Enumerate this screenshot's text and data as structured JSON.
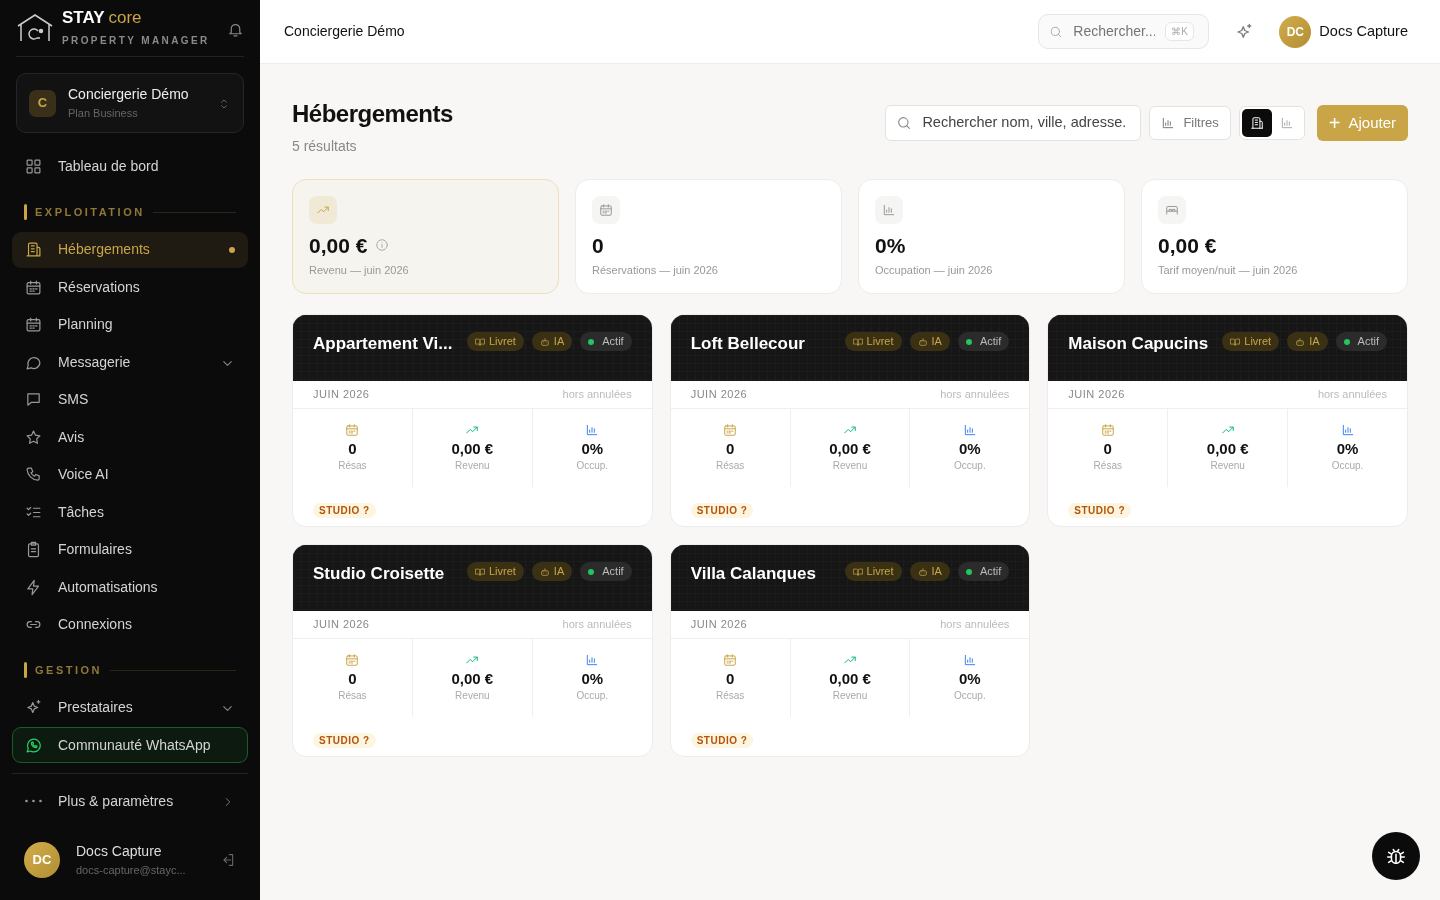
{
  "sidebar": {
    "brand": {
      "name": "STAY",
      "suffix": "core",
      "tagline": "PROPERTY MANAGER"
    },
    "org": {
      "initial": "C",
      "name": "Conciergerie Démo",
      "plan": "Plan Business"
    },
    "items": [
      {
        "kind": "link",
        "label": "Tableau de bord",
        "selected": false
      },
      {
        "kind": "section",
        "label": "EXPLOITATION"
      },
      {
        "kind": "link",
        "label": "Hébergements",
        "selected": true
      },
      {
        "kind": "link",
        "label": "Réservations",
        "selected": false
      },
      {
        "kind": "link",
        "label": "Planning",
        "selected": false
      },
      {
        "kind": "group",
        "label": "Messagerie",
        "expanded": false
      },
      {
        "kind": "link",
        "label": "SMS",
        "selected": false
      },
      {
        "kind": "link",
        "label": "Avis",
        "selected": false
      },
      {
        "kind": "link",
        "label": "Voice AI",
        "selected": false
      },
      {
        "kind": "link",
        "label": "Tâches",
        "selected": false
      },
      {
        "kind": "link",
        "label": "Formulaires",
        "selected": false
      },
      {
        "kind": "link",
        "label": "Automatisations",
        "selected": false
      },
      {
        "kind": "link",
        "label": "Connexions",
        "selected": false
      },
      {
        "kind": "section",
        "label": "GESTION"
      },
      {
        "kind": "group",
        "label": "Prestataires",
        "expanded": false
      },
      {
        "kind": "whatsapp",
        "label": "Communauté WhatsApp"
      },
      {
        "kind": "more",
        "label": "Plus & paramètres"
      }
    ],
    "user": {
      "initials": "DC",
      "name": "Docs Capture",
      "email": "docs-capture@stayc..."
    }
  },
  "topbar": {
    "title": "Conciergerie Démo",
    "search": {
      "placeholder": "Rechercher...",
      "shortcut": "⌘K"
    },
    "user": {
      "initials": "DC",
      "name": "Docs Capture"
    }
  },
  "page": {
    "title": "Hébergements",
    "count": "5 résultats",
    "search": {
      "placeholder": "Rechercher nom, ville, adresse."
    },
    "filters": "Filtres",
    "views": [
      {
        "kind": "grid",
        "selected": true
      },
      {
        "kind": "stats",
        "selected": false
      }
    ],
    "add": {
      "icon": "+",
      "label": "Ajouter"
    }
  },
  "stats": [
    {
      "kind": "revenue",
      "value": "0,00 €",
      "label": "Revenu — juin 2026",
      "highlighted": true,
      "info": true
    },
    {
      "kind": "bookings",
      "value": "0",
      "label": "Réservations — juin 2026",
      "highlighted": false,
      "info": false
    },
    {
      "kind": "occupancy",
      "value": "0%",
      "label": "Occupation — juin 2026",
      "highlighted": false,
      "info": false
    },
    {
      "kind": "rate",
      "value": "0,00 €",
      "label": "Tarif moyen/nuit — juin 2026",
      "highlighted": false,
      "info": false
    }
  ],
  "properties": [
    {
      "name": "Appartement Vi...",
      "badges": [
        {
          "kind": "guide",
          "label": "Livret"
        },
        {
          "kind": "ai",
          "label": "IA"
        },
        {
          "kind": "status",
          "label": "Actif",
          "color": "#22c55e"
        }
      ],
      "month": "JUIN 2026",
      "note": "hors annulées",
      "metrics": [
        {
          "value": "0",
          "label": "Résas"
        },
        {
          "value": "0,00 €",
          "label": "Revenu"
        },
        {
          "value": "0%",
          "label": "Occup."
        }
      ],
      "tag": "STUDIO ?"
    },
    {
      "name": "Loft Bellecour",
      "badges": [
        {
          "kind": "guide",
          "label": "Livret"
        },
        {
          "kind": "ai",
          "label": "IA"
        },
        {
          "kind": "status",
          "label": "Actif",
          "color": "#22c55e"
        }
      ],
      "month": "JUIN 2026",
      "note": "hors annulées",
      "metrics": [
        {
          "value": "0",
          "label": "Résas"
        },
        {
          "value": "0,00 €",
          "label": "Revenu"
        },
        {
          "value": "0%",
          "label": "Occup."
        }
      ],
      "tag": "STUDIO ?"
    },
    {
      "name": "Maison Capucins",
      "badges": [
        {
          "kind": "guide",
          "label": "Livret"
        },
        {
          "kind": "ai",
          "label": "IA"
        },
        {
          "kind": "status",
          "label": "Actif",
          "color": "#22c55e"
        }
      ],
      "month": "JUIN 2026",
      "note": "hors annulées",
      "metrics": [
        {
          "value": "0",
          "label": "Résas"
        },
        {
          "value": "0,00 €",
          "label": "Revenu"
        },
        {
          "value": "0%",
          "label": "Occup."
        }
      ],
      "tag": "STUDIO ?"
    },
    {
      "name": "Studio Croisette",
      "badges": [
        {
          "kind": "guide",
          "label": "Livret"
        },
        {
          "kind": "ai",
          "label": "IA"
        },
        {
          "kind": "status",
          "label": "Actif",
          "color": "#22c55e"
        }
      ],
      "month": "JUIN 2026",
      "note": "hors annulées",
      "metrics": [
        {
          "value": "0",
          "label": "Résas"
        },
        {
          "value": "0,00 €",
          "label": "Revenu"
        },
        {
          "value": "0%",
          "label": "Occup."
        }
      ],
      "tag": "STUDIO ?"
    },
    {
      "name": "Villa Calanques",
      "badges": [
        {
          "kind": "guide",
          "label": "Livret"
        },
        {
          "kind": "ai",
          "label": "IA"
        },
        {
          "kind": "status",
          "label": "Actif",
          "color": "#22c55e"
        }
      ],
      "month": "JUIN 2026",
      "note": "hors annulées",
      "metrics": [
        {
          "value": "0",
          "label": "Résas"
        },
        {
          "value": "0,00 €",
          "label": "Revenu"
        },
        {
          "value": "0%",
          "label": "Occup."
        }
      ],
      "tag": "STUDIO ?"
    }
  ]
}
